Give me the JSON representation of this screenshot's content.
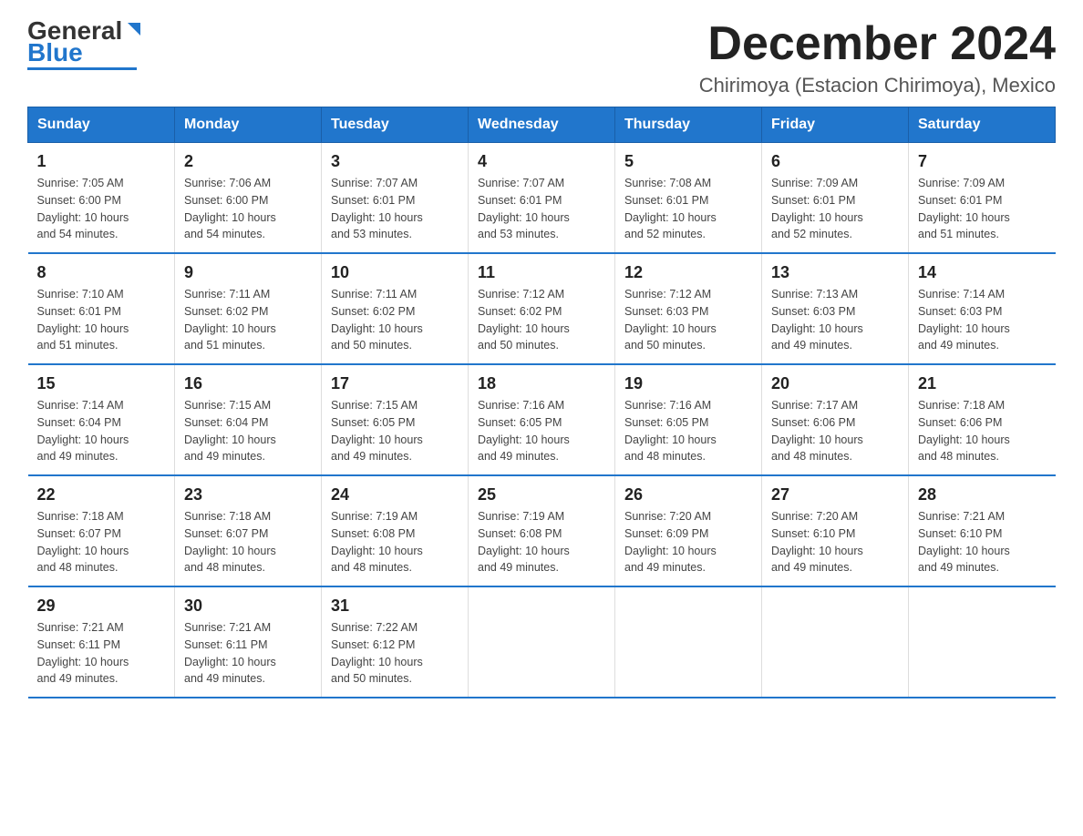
{
  "header": {
    "logo_general": "General",
    "logo_blue": "Blue",
    "main_title": "December 2024",
    "subtitle": "Chirimoya (Estacion Chirimoya), Mexico"
  },
  "calendar": {
    "days_of_week": [
      "Sunday",
      "Monday",
      "Tuesday",
      "Wednesday",
      "Thursday",
      "Friday",
      "Saturday"
    ],
    "weeks": [
      [
        {
          "day": "1",
          "info": "Sunrise: 7:05 AM\nSunset: 6:00 PM\nDaylight: 10 hours\nand 54 minutes."
        },
        {
          "day": "2",
          "info": "Sunrise: 7:06 AM\nSunset: 6:00 PM\nDaylight: 10 hours\nand 54 minutes."
        },
        {
          "day": "3",
          "info": "Sunrise: 7:07 AM\nSunset: 6:01 PM\nDaylight: 10 hours\nand 53 minutes."
        },
        {
          "day": "4",
          "info": "Sunrise: 7:07 AM\nSunset: 6:01 PM\nDaylight: 10 hours\nand 53 minutes."
        },
        {
          "day": "5",
          "info": "Sunrise: 7:08 AM\nSunset: 6:01 PM\nDaylight: 10 hours\nand 52 minutes."
        },
        {
          "day": "6",
          "info": "Sunrise: 7:09 AM\nSunset: 6:01 PM\nDaylight: 10 hours\nand 52 minutes."
        },
        {
          "day": "7",
          "info": "Sunrise: 7:09 AM\nSunset: 6:01 PM\nDaylight: 10 hours\nand 51 minutes."
        }
      ],
      [
        {
          "day": "8",
          "info": "Sunrise: 7:10 AM\nSunset: 6:01 PM\nDaylight: 10 hours\nand 51 minutes."
        },
        {
          "day": "9",
          "info": "Sunrise: 7:11 AM\nSunset: 6:02 PM\nDaylight: 10 hours\nand 51 minutes."
        },
        {
          "day": "10",
          "info": "Sunrise: 7:11 AM\nSunset: 6:02 PM\nDaylight: 10 hours\nand 50 minutes."
        },
        {
          "day": "11",
          "info": "Sunrise: 7:12 AM\nSunset: 6:02 PM\nDaylight: 10 hours\nand 50 minutes."
        },
        {
          "day": "12",
          "info": "Sunrise: 7:12 AM\nSunset: 6:03 PM\nDaylight: 10 hours\nand 50 minutes."
        },
        {
          "day": "13",
          "info": "Sunrise: 7:13 AM\nSunset: 6:03 PM\nDaylight: 10 hours\nand 49 minutes."
        },
        {
          "day": "14",
          "info": "Sunrise: 7:14 AM\nSunset: 6:03 PM\nDaylight: 10 hours\nand 49 minutes."
        }
      ],
      [
        {
          "day": "15",
          "info": "Sunrise: 7:14 AM\nSunset: 6:04 PM\nDaylight: 10 hours\nand 49 minutes."
        },
        {
          "day": "16",
          "info": "Sunrise: 7:15 AM\nSunset: 6:04 PM\nDaylight: 10 hours\nand 49 minutes."
        },
        {
          "day": "17",
          "info": "Sunrise: 7:15 AM\nSunset: 6:05 PM\nDaylight: 10 hours\nand 49 minutes."
        },
        {
          "day": "18",
          "info": "Sunrise: 7:16 AM\nSunset: 6:05 PM\nDaylight: 10 hours\nand 49 minutes."
        },
        {
          "day": "19",
          "info": "Sunrise: 7:16 AM\nSunset: 6:05 PM\nDaylight: 10 hours\nand 48 minutes."
        },
        {
          "day": "20",
          "info": "Sunrise: 7:17 AM\nSunset: 6:06 PM\nDaylight: 10 hours\nand 48 minutes."
        },
        {
          "day": "21",
          "info": "Sunrise: 7:18 AM\nSunset: 6:06 PM\nDaylight: 10 hours\nand 48 minutes."
        }
      ],
      [
        {
          "day": "22",
          "info": "Sunrise: 7:18 AM\nSunset: 6:07 PM\nDaylight: 10 hours\nand 48 minutes."
        },
        {
          "day": "23",
          "info": "Sunrise: 7:18 AM\nSunset: 6:07 PM\nDaylight: 10 hours\nand 48 minutes."
        },
        {
          "day": "24",
          "info": "Sunrise: 7:19 AM\nSunset: 6:08 PM\nDaylight: 10 hours\nand 48 minutes."
        },
        {
          "day": "25",
          "info": "Sunrise: 7:19 AM\nSunset: 6:08 PM\nDaylight: 10 hours\nand 49 minutes."
        },
        {
          "day": "26",
          "info": "Sunrise: 7:20 AM\nSunset: 6:09 PM\nDaylight: 10 hours\nand 49 minutes."
        },
        {
          "day": "27",
          "info": "Sunrise: 7:20 AM\nSunset: 6:10 PM\nDaylight: 10 hours\nand 49 minutes."
        },
        {
          "day": "28",
          "info": "Sunrise: 7:21 AM\nSunset: 6:10 PM\nDaylight: 10 hours\nand 49 minutes."
        }
      ],
      [
        {
          "day": "29",
          "info": "Sunrise: 7:21 AM\nSunset: 6:11 PM\nDaylight: 10 hours\nand 49 minutes."
        },
        {
          "day": "30",
          "info": "Sunrise: 7:21 AM\nSunset: 6:11 PM\nDaylight: 10 hours\nand 49 minutes."
        },
        {
          "day": "31",
          "info": "Sunrise: 7:22 AM\nSunset: 6:12 PM\nDaylight: 10 hours\nand 50 minutes."
        },
        {
          "day": "",
          "info": ""
        },
        {
          "day": "",
          "info": ""
        },
        {
          "day": "",
          "info": ""
        },
        {
          "day": "",
          "info": ""
        }
      ]
    ]
  }
}
